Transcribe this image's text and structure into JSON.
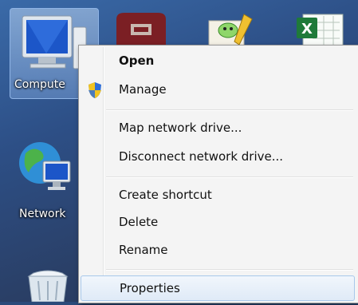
{
  "desktop": {
    "icons": [
      {
        "label": "Compute",
        "icon": "computer-icon"
      },
      {
        "label": "Network",
        "icon": "network-icon"
      },
      {
        "label": "",
        "icon": "recycle-bin-icon"
      },
      {
        "label": "",
        "icon": "archive-app-icon"
      },
      {
        "label": "",
        "icon": "notepad-app-icon"
      },
      {
        "label": "",
        "icon": "excel-file-icon"
      }
    ]
  },
  "context_menu": {
    "items": [
      {
        "label": "Open",
        "bold": true
      },
      {
        "label": "Manage",
        "icon": "uac-shield-icon"
      },
      {
        "label": "Map network drive..."
      },
      {
        "label": "Disconnect network drive..."
      },
      {
        "label": "Create shortcut"
      },
      {
        "label": "Delete"
      },
      {
        "label": "Rename"
      },
      {
        "label": "Properties",
        "highlighted": true
      }
    ]
  },
  "colors": {
    "menu_bg": "#f4f4f4",
    "highlight_border": "#a8c8eb",
    "desktop_bg": "#2d4f86"
  }
}
